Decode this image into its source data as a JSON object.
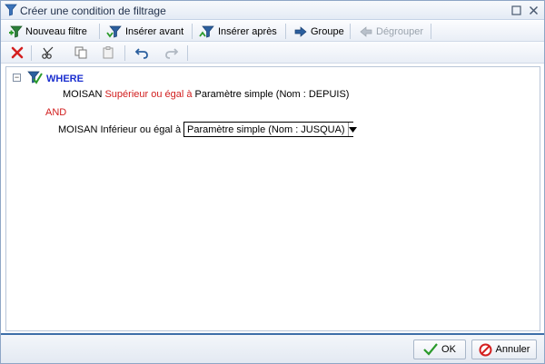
{
  "window": {
    "title": "Créer une condition de filtrage"
  },
  "toolbar": {
    "nouveau_filtre": "Nouveau filtre",
    "inserer_avant": "Insérer avant",
    "inserer_apres": "Insérer après",
    "groupe": "Groupe",
    "degrouper": "Dégrouper"
  },
  "filter": {
    "where": "WHERE",
    "and": "AND",
    "conditions": [
      {
        "field": "MOISAN",
        "operator": "Supérieur ou égal à",
        "value": "Paramètre simple (Nom : DEPUIS)"
      },
      {
        "field": "MOISAN",
        "operator": "Inférieur ou égal à",
        "value": "Paramètre simple (Nom : JUSQUA)"
      }
    ]
  },
  "footer": {
    "ok": "OK",
    "cancel": "Annuler"
  },
  "colors": {
    "keyword_blue": "#1b2fcf",
    "operator_red": "#d11d1d",
    "footer_border": "#3d6ea8"
  }
}
